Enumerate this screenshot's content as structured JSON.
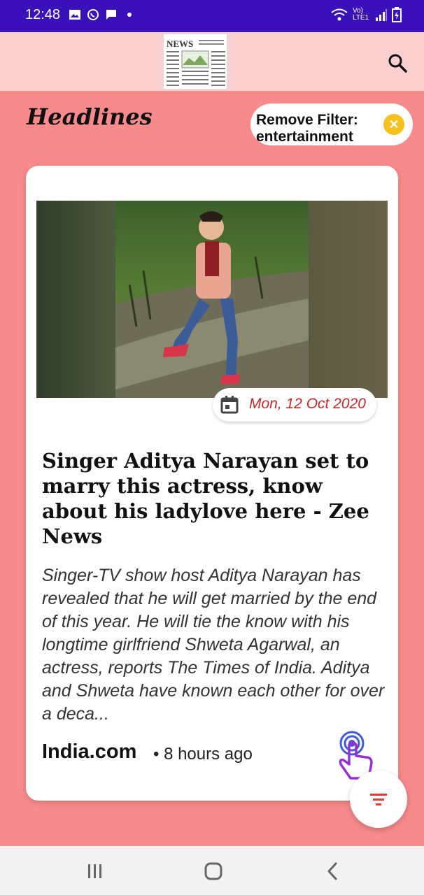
{
  "status_bar": {
    "time": "12:48",
    "network": "Vo) LTE1"
  },
  "app_bar": {
    "logo_text": "NEWS"
  },
  "headlines": {
    "title": "Headlines",
    "filter_label": "Remove Filter: entertainment"
  },
  "article": {
    "date": "Mon, 12 Oct 2020",
    "title": "Singer Aditya Narayan set to marry this actress, know about his ladylove here - Zee News",
    "description": "Singer-TV show host Aditya Narayan has revealed that he will get married by the end of this year. He will tie the know with his longtime girlfriend Shweta Agarwal, an actress, reports The Times of India. Aditya and Shweta have known each other for over a deca...",
    "source": "India.com",
    "time_ago": "• 8 hours ago"
  },
  "colors": {
    "status_bar": "#3a10b8",
    "app_bar": "#f9cfcf",
    "background": "#f78a8a",
    "accent": "#c62828",
    "chip_close": "#f7c11a"
  },
  "icons": [
    "image-icon",
    "whatsapp-icon",
    "message-icon",
    "wifi-icon",
    "signal-icon",
    "battery-icon",
    "search-icon",
    "calendar-icon",
    "tap-gesture-icon",
    "filter-icon",
    "recent-apps-icon",
    "home-icon",
    "back-icon"
  ]
}
